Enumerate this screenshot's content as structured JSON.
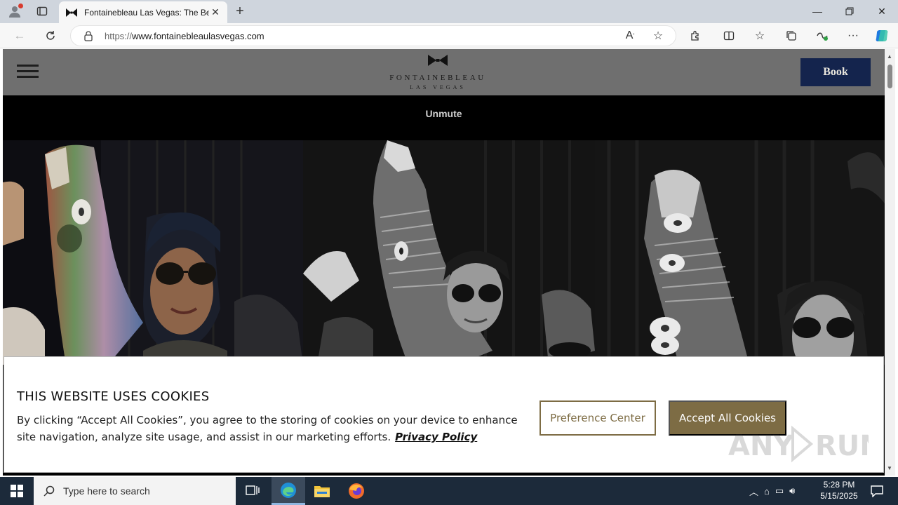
{
  "browser": {
    "tab_title": "Fontainebleau Las Vegas: The Best",
    "url_prefix": "https://",
    "url_host": "www.fontainebleaulasvegas.com",
    "icons": [
      "profile-icon",
      "tab-actions-icon",
      "close-tab-icon",
      "new-tab-icon",
      "minimize-icon",
      "restore-icon",
      "close-window-icon",
      "back-icon",
      "refresh-icon",
      "lock-icon",
      "read-aloud-icon",
      "favorite-icon",
      "extensions-icon",
      "split-screen-icon",
      "favorites-icon",
      "collections-icon",
      "browser-essentials-icon",
      "more-icon",
      "copilot-icon"
    ]
  },
  "site": {
    "logo_name": "FONTAINEBLEAU",
    "logo_sub": "LAS VEGAS",
    "book_label": "Book",
    "unmute_label": "Unmute"
  },
  "cookie": {
    "heading": "THIS WEBSITE USES COOKIES",
    "body": "By clicking “Accept All Cookies”, you agree to the storing of cookies on your device to enhance site navigation, analyze site usage, and assist in our marketing efforts.",
    "privacy_link": "Privacy Policy",
    "preference_label": "Preference Center",
    "accept_label": "Accept All Cookies",
    "accent_color": "#7d6c44"
  },
  "watermark": "ANY RUN",
  "taskbar": {
    "search_placeholder": "Type here to search",
    "time": "5:28 PM",
    "date": "5/15/2025"
  }
}
